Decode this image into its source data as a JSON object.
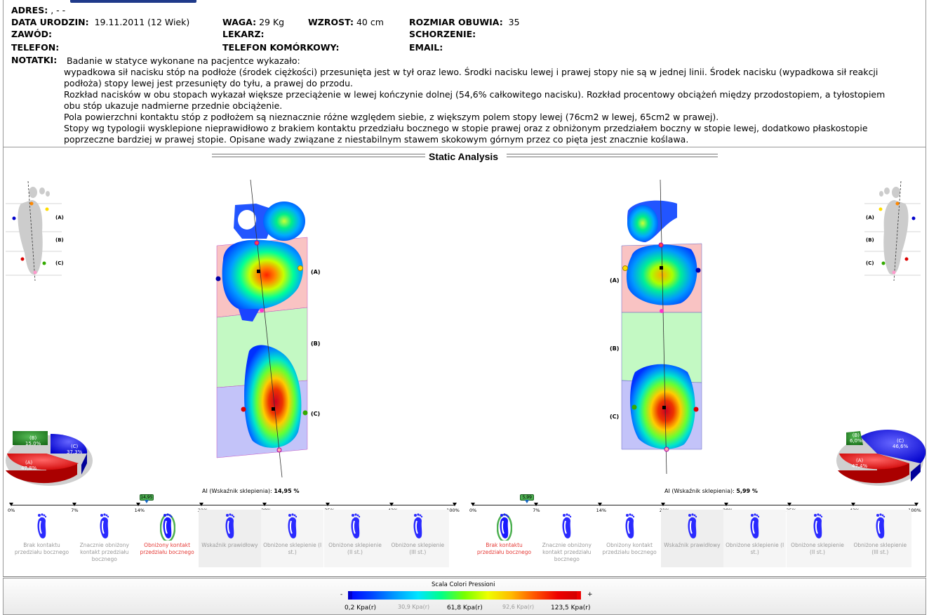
{
  "header": {
    "adres_label": "ADRES:",
    "adres_value": ",    -   -",
    "dob_label": "DATA URODZIN:",
    "dob_value": "19.11.2011 (12 Wiek)",
    "waga_label": "WAGA:",
    "waga_value": "29 Kg",
    "wzrost_label": "WZROST:",
    "wzrost_value": "40 cm",
    "obuwie_label": "ROZMIAR OBUWIA:",
    "obuwie_value": "35",
    "zawod_label": "ZAWÓD:",
    "lekarz_label": "LEKARZ:",
    "schorzenie_label": "SCHORZENIE:",
    "telefon_label": "TELEFON:",
    "telkom_label": "TELEFON KOMÓRKOWY:",
    "email_label": "EMAIL:",
    "notatki_label": "NOTATKI:",
    "notes": [
      "Badanie w statyce wykonane na pacjentce wykazało:",
      "wypadkowa sił nacisku stóp na podłoże (środek ciężkości) przesunięta jest w tył oraz lewo. Środki nacisku lewej i prawej stopy nie są w jednej linii. Środek nacisku (wypadkowa sił reakcji podłoża) stopy lewej jest przesunięty do tyłu, a prawej do przodu.",
      "Rozkład nacisków w obu stopach wykazał większe przeciążenie w lewej kończynie dolnej (54,6% całkowitego nacisku). Rozkład procentowy obciążeń między przodostopiem, a tyłostopiem obu stóp ukazuje nadmierne przednie obciążenie.",
      "Pola powierzchni kontaktu stóp z podłożem są nieznacznie różne względem siebie, z  większym polem stopy lewej (76cm2  w lewej, 65cm2 w prawej).",
      "Stopy wg typologii wysklepione nieprawidłowo z brakiem kontaktu przedziału bocznego w stopie prawej oraz z obniżonym przedziałem boczny w stopie lewej, dodatkowo płaskostopie poprzeczne bardziej w prawej stopie. Opisane wady związane z niestabilnym stawem skokowym górnym przez co pięta jest znacznie koślawa."
    ]
  },
  "analysis": {
    "title": "Static Analysis",
    "zone_a": "(A)",
    "zone_b": "(B)",
    "zone_c": "(C)",
    "left": {
      "pie": {
        "a": "47,8%",
        "b": "15,0%",
        "c": "37,3%"
      },
      "ai_label": "AI (Wskaźnik sklepienia):",
      "ai_value": "14,95 %",
      "marker": "14,95",
      "marker_pct": 14.95,
      "selected": 2
    },
    "right": {
      "pie": {
        "a": "47,4%",
        "b": "6,0%",
        "c": "46,6%"
      },
      "ai_label": "AI (Wskaźnik sklepienia):",
      "ai_value": "5,99 %",
      "marker": "5,99",
      "marker_pct": 5.99,
      "selected": 0
    },
    "ticks": [
      "0%",
      "7%",
      "14%",
      "21%",
      "28%",
      "35%",
      "42%",
      "...100%"
    ],
    "categories": [
      "Brak kontaktu przedziału bocznego",
      "Znacznie obniżony kontakt przedziału bocznego",
      "Obniżony kontakt przedziału bocznego",
      "Wskaźnik prawidłowy",
      "Obniżone sklepienie (I st.)",
      "Obniżone sklepienie (II st.)",
      "Obniżone sklepienie (III st.)"
    ]
  },
  "legend": {
    "title": "Scala Colori Pressioni",
    "minus": "-",
    "plus": "+",
    "v0": "0,2 Kpa(r)",
    "v1": "30,9 Kpa(r)",
    "v2": "61,8 Kpa(r)",
    "v3": "92,6 Kpa(r)",
    "v4": "123,5 Kpa(r)"
  },
  "colors": {
    "zone_a": "#f9c3c3",
    "zone_b": "#c3f9c3",
    "zone_c": "#c3c3f9",
    "pie_a": "#ee1111",
    "pie_b": "#2e8b2e",
    "pie_c": "#2222ee",
    "sel_text": "#e53935"
  }
}
